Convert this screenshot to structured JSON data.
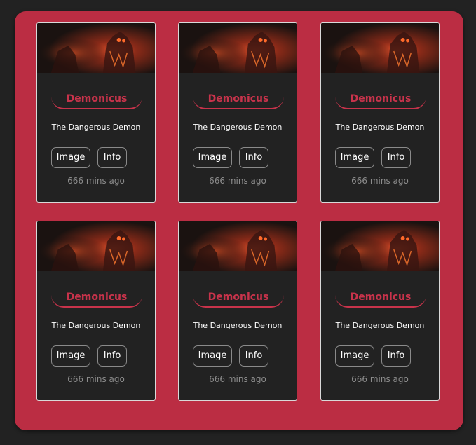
{
  "cards": [
    {
      "title": "Demonicus",
      "subtitle": "The Dangerous Demon",
      "image_label": "Image",
      "info_label": "Info",
      "time": "666 mins ago"
    },
    {
      "title": "Demonicus",
      "subtitle": "The Dangerous Demon",
      "image_label": "Image",
      "info_label": "Info",
      "time": "666 mins ago"
    },
    {
      "title": "Demonicus",
      "subtitle": "The Dangerous Demon",
      "image_label": "Image",
      "info_label": "Info",
      "time": "666 mins ago"
    },
    {
      "title": "Demonicus",
      "subtitle": "The Dangerous Demon",
      "image_label": "Image",
      "info_label": "Info",
      "time": "666 mins ago"
    },
    {
      "title": "Demonicus",
      "subtitle": "The Dangerous Demon",
      "image_label": "Image",
      "info_label": "Info",
      "time": "666 mins ago"
    },
    {
      "title": "Demonicus",
      "subtitle": "The Dangerous Demon",
      "image_label": "Image",
      "info_label": "Info",
      "time": "666 mins ago"
    }
  ],
  "colors": {
    "page_background": "#222222",
    "panel_background": "#bb2d43",
    "card_background": "#222222",
    "accent": "#c8334b",
    "muted_text": "#8c8c8c"
  }
}
